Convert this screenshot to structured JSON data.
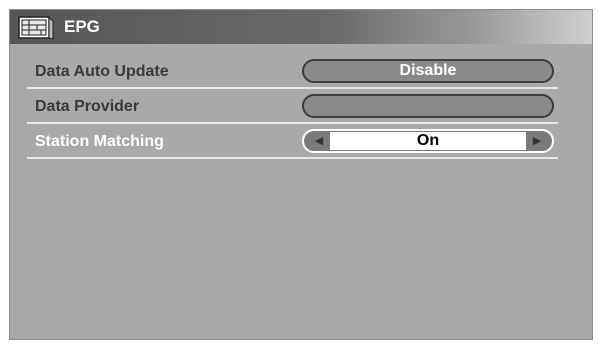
{
  "header": {
    "title": "EPG",
    "icon": "program-guide-icon"
  },
  "menu": {
    "items": [
      {
        "label": "Data Auto Update",
        "value": "Disable"
      },
      {
        "label": "Data Provider",
        "value": ""
      },
      {
        "label": "Station Matching",
        "value": "On",
        "selected": true
      }
    ]
  },
  "colors": {
    "panel": "#a9a9a9",
    "title_bar": "#555555",
    "highlight_text": "#ffffff"
  }
}
